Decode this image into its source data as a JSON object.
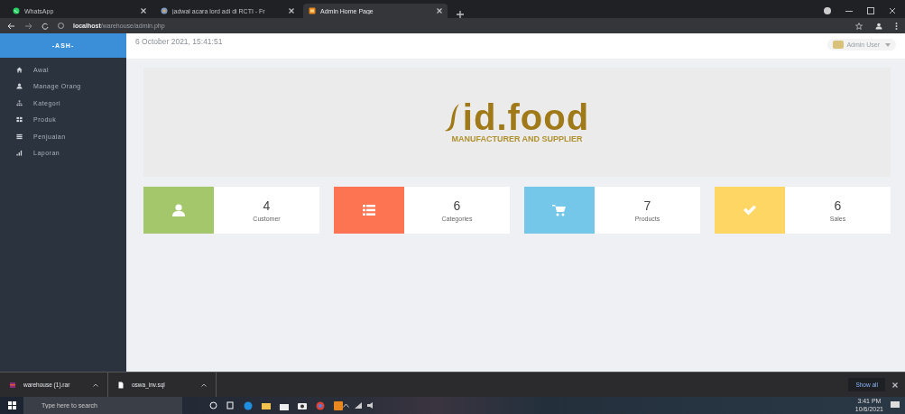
{
  "browser": {
    "tabs": [
      {
        "title": "WhatsApp",
        "kind": "whatsapp",
        "selected": false
      },
      {
        "title": "jadwal acara lord adi di RCTI - Fr",
        "kind": "globe",
        "selected": false
      },
      {
        "title": "Admin Home Page",
        "kind": "site",
        "selected": true
      }
    ],
    "address": "**localhost**/warehouse/admin.php"
  },
  "sidebar": {
    "brand": "-ASH-",
    "items": [
      {
        "label": "Awal",
        "kind": "home"
      },
      {
        "label": "Manage Orang",
        "kind": "user"
      },
      {
        "label": "Kategori",
        "kind": "sitemap"
      },
      {
        "label": "Produk",
        "kind": "grid"
      },
      {
        "label": "Penjualan",
        "kind": "table"
      },
      {
        "label": "Laporan",
        "kind": "chart"
      }
    ]
  },
  "header": {
    "datetime": "6 October 2021, 15:41:51",
    "user": "Admin User"
  },
  "banner": {
    "logo": "id.food",
    "tagline": "MANUFACTURER AND SUPPLIER"
  },
  "stats": [
    {
      "value": "4",
      "label": "Customer",
      "kind": "user",
      "color": "#a3c76a"
    },
    {
      "value": "6",
      "label": "Categories",
      "kind": "list",
      "color": "#fd7453"
    },
    {
      "value": "7",
      "label": "Products",
      "kind": "cart",
      "color": "#75c7ea"
    },
    {
      "value": "6",
      "label": "Sales",
      "kind": "check",
      "color": "#fdd664"
    }
  ],
  "downloads": {
    "files": [
      {
        "name": "warehouse (1).rar",
        "kind": "archive"
      },
      {
        "name": "oswa_inv.sql",
        "kind": "file"
      }
    ],
    "show_all": "Show all"
  },
  "taskbar": {
    "search_placeholder": "Type here to search",
    "time": "3:41 PM",
    "date": "10/6/2021"
  }
}
